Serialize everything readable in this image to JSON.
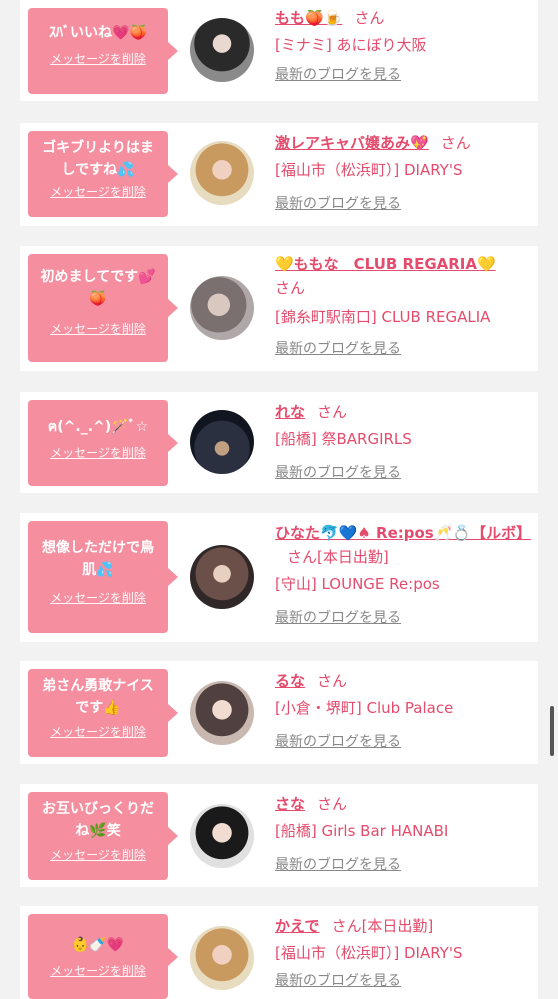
{
  "colors": {
    "accent": "#e54b6c",
    "bubble": "#f58fa0",
    "link_gray": "#888888",
    "page_bg": "#f2f2f2"
  },
  "delete_label": "メッセージを削除",
  "blog_label": "最新のブログを見る",
  "items": [
    {
      "message": "ｽﾊﾞいいね💗🍑",
      "name": "もも🍑🍺",
      "san": "さん",
      "extra": "",
      "shop": "[ミナミ] あにぼり大阪"
    },
    {
      "message": "ゴキブリよりはましですね💦",
      "name": "激レアキャバ嬢あみ💖",
      "san": "さん",
      "extra": "",
      "shop": "[福山市（松浜町）] DIARY'S"
    },
    {
      "message": "初めましてです💕🍑",
      "name": "💛ももな　CLUB REGARIA💛",
      "san": "さん",
      "extra": "",
      "shop": "[錦糸町駅南口] CLUB REGALIA"
    },
    {
      "message": "ฅ(^._.^)🪄ﾞ☆",
      "name": "れな",
      "san": "さん",
      "extra": "",
      "shop": "[船橋] 祭BARGIRLS"
    },
    {
      "message": "想像しただけで鳥肌💦",
      "name": "ひなた🐬💙♠ Re:pos🥂💍【ルボ】",
      "san": "さん",
      "extra": "[本日出勤]",
      "shop": "[守山] LOUNGE Re:pos"
    },
    {
      "message": "弟さん勇敢ナイスです👍",
      "name": "るな",
      "san": "さん",
      "extra": "",
      "shop": "[小倉・堺町] Club Palace"
    },
    {
      "message": "お互いびっくりだね🌿笑",
      "name": "さな",
      "san": "さん",
      "extra": "",
      "shop": "[船橋] Girls Bar HANABI"
    },
    {
      "message": "👶🍼💗",
      "name": "かえで",
      "san": "さん",
      "extra": "[本日出勤]",
      "shop": "[福山市（松浜町）] DIARY'S"
    }
  ]
}
